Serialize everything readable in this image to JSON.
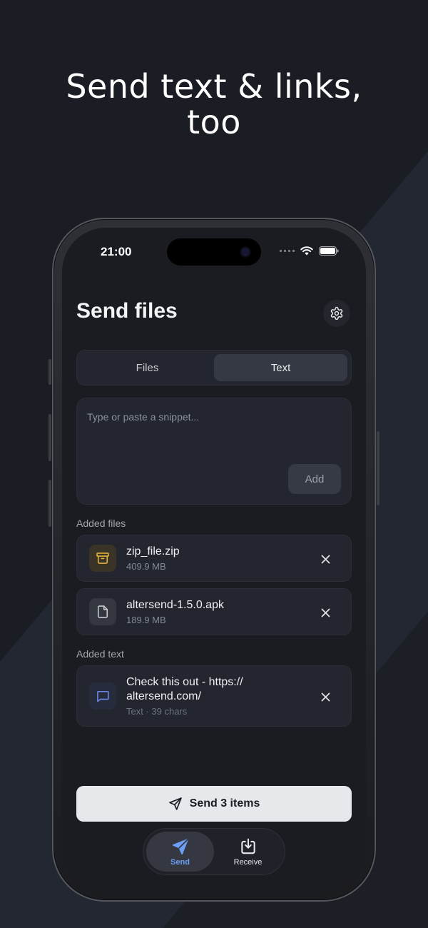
{
  "headline": {
    "line1": "Send text & links,",
    "line2": "too"
  },
  "status_bar": {
    "time": "21:00"
  },
  "page": {
    "title": "Send files"
  },
  "segmented": {
    "tabs": [
      {
        "label": "Files"
      },
      {
        "label": "Text"
      }
    ],
    "selected": "Text"
  },
  "snippet": {
    "placeholder": "Type or paste a snippet...",
    "add_label": "Add"
  },
  "sections": {
    "files_label": "Added files",
    "text_label": "Added text"
  },
  "files": [
    {
      "name": "zip_file.zip",
      "size": "409.9 MB",
      "icon": "archive-icon",
      "icon_color": "#e3b341"
    },
    {
      "name": "altersend-1.5.0.apk",
      "size": "189.9 MB",
      "icon": "file-icon",
      "icon_color": "#c7cad0"
    }
  ],
  "texts": [
    {
      "line1": "Check this out - https://",
      "line2": "altersend.com/",
      "meta": "Text · 39 chars",
      "icon": "message-icon",
      "icon_color": "#6d86e8"
    }
  ],
  "send_button": {
    "label": "Send 3 items"
  },
  "tabbar": {
    "items": [
      {
        "label": "Send",
        "icon": "send-icon"
      },
      {
        "label": "Receive",
        "icon": "download-icon"
      }
    ],
    "active": "Send"
  },
  "colors": {
    "accent": "#6d9ff5",
    "background": "#1a1d23",
    "card": "#23262e"
  }
}
